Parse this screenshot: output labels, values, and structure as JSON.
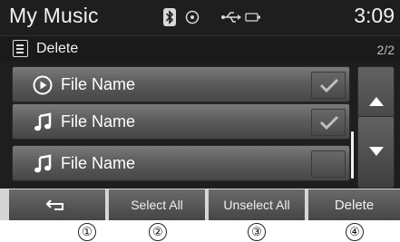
{
  "header": {
    "title": "My Music",
    "time": "3:09",
    "status_icons": [
      "bluetooth-icon",
      "disc-icon",
      "usb-icon",
      "battery-icon"
    ]
  },
  "subheader": {
    "icon": "list-icon",
    "label": "Delete",
    "page_indicator": "2/2"
  },
  "list": {
    "items": [
      {
        "label": "File Name",
        "icon": "play-circle-icon",
        "checked": true
      },
      {
        "label": "File Name",
        "icon": "music-note-icon",
        "checked": true
      },
      {
        "label": "File Name",
        "icon": "music-note-icon",
        "checked": false
      }
    ]
  },
  "scroll": {
    "up_icon": "scroll-up-icon",
    "down_icon": "scroll-down-icon"
  },
  "bottom_bar": {
    "back_icon": "back-arrow-icon",
    "select_all": "Select All",
    "unselect_all": "Unselect All",
    "delete": "Delete"
  },
  "callouts": [
    "①",
    "②",
    "③",
    "④"
  ],
  "colors": {
    "screen_bg": "#1e1e1e",
    "button_gray": "#5d5d5d",
    "text": "#ffffff"
  }
}
